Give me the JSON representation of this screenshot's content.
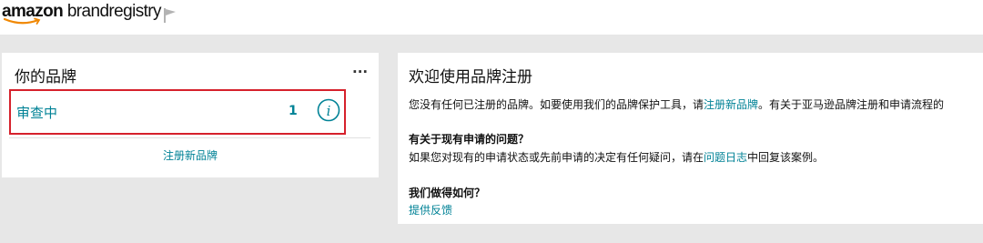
{
  "header": {
    "logo_text_bold": "amazon",
    "logo_text_rest": " brandregistry",
    "flag_icon": "flag-icon"
  },
  "brands_card": {
    "title": "你的品牌",
    "menu_label": "···",
    "row": {
      "status": "审查中",
      "count": "1",
      "icon": "info-icon"
    },
    "register_link": "注册新品牌",
    "accent_color": "#008296",
    "highlight_color": "#d6212c"
  },
  "welcome_card": {
    "title": "欢迎使用品牌注册",
    "intro_pre": "您没有任何已注册的品牌。如要使用我们的品牌保护工具，请",
    "intro_link": "注册新品牌",
    "intro_post": "。有关于亚马逊品牌注册和申请流程的",
    "question_heading": "有关于现有申请的问题？",
    "question_pre": "如果您对现有的申请状态或先前申请的决定有任何疑问，请在",
    "question_link": "问题日志",
    "question_post": "中回复该案例。",
    "feedback_heading": "我们做得如何？",
    "feedback_link": "提供反馈"
  }
}
